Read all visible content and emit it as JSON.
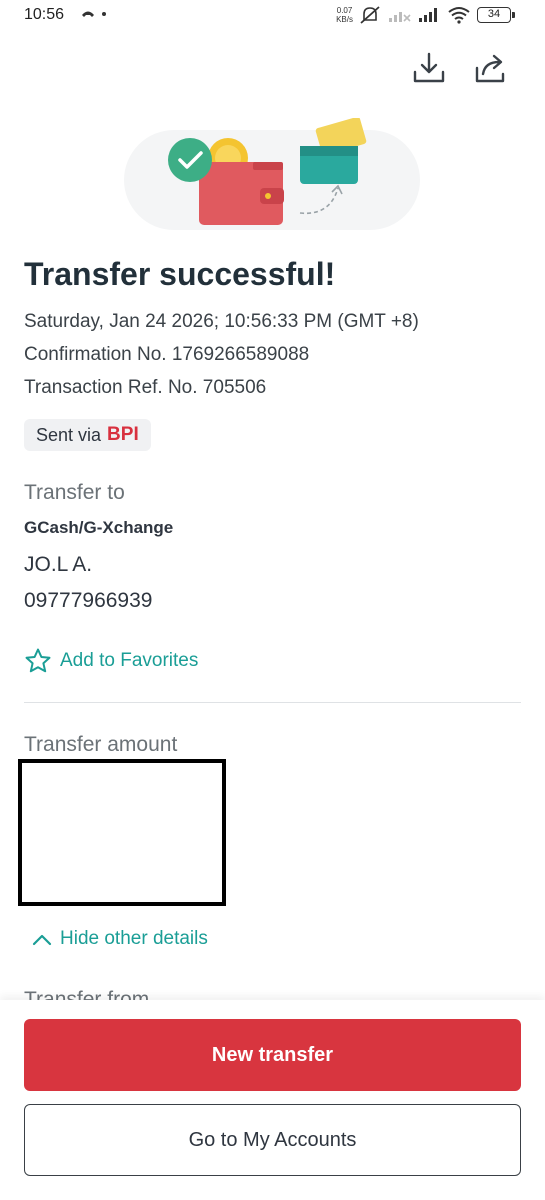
{
  "status_bar": {
    "time": "10:56",
    "net_speed_value": "0.07",
    "net_speed_unit": "KB/s",
    "battery": "34"
  },
  "header": {
    "download_icon": "download-icon",
    "share_icon": "share-icon"
  },
  "receipt": {
    "title": "Transfer successful!",
    "date": "Saturday, Jan 24 2026; 10:56:33 PM (GMT +8)",
    "confirmation": "Confirmation No. 1769266589088",
    "reference": "Transaction Ref. No. 705506",
    "sent_via_label": "Sent via",
    "sent_via_bank": "BPI"
  },
  "transfer_to": {
    "label": "Transfer to",
    "bank": "GCash/G-Xchange",
    "name": "JO.L A.",
    "number": "09777966939",
    "favorites_label": "Add to Favorites"
  },
  "amount": {
    "label": "Transfer amount"
  },
  "details": {
    "hide_label": "Hide other details",
    "transfer_from_label": "Transfer from"
  },
  "actions": {
    "new_transfer": "New transfer",
    "go_to_accounts": "Go to My Accounts"
  },
  "colors": {
    "brand_red": "#d8353f",
    "teal_link": "#1a9e96"
  }
}
